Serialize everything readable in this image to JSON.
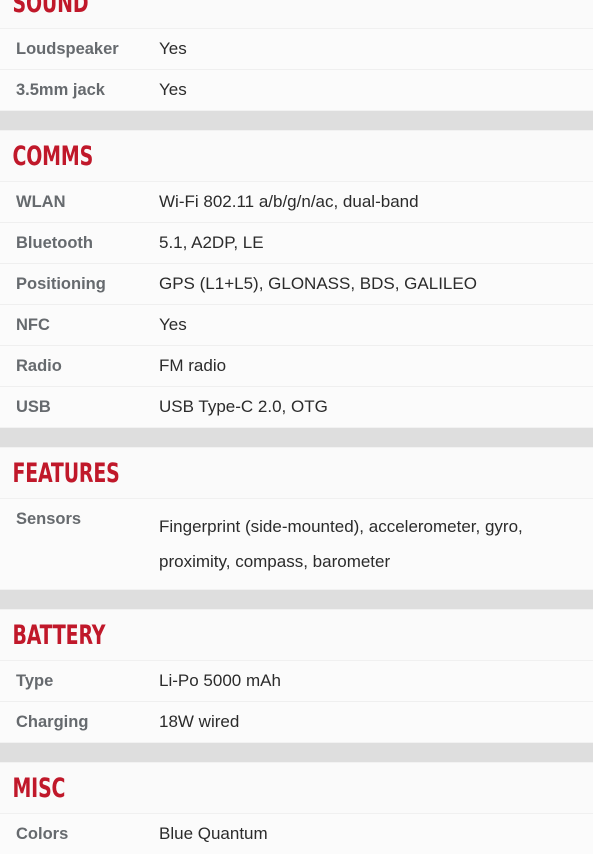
{
  "accent_color": "#c0182a",
  "label_color": "#666a6e",
  "value_color": "#2b2b2b",
  "separator_color": "#dedede",
  "background_color": "#fafafa",
  "page": {
    "type": "phone-specifications-table"
  },
  "sections": [
    {
      "id": "sound",
      "heading": "SOUND",
      "clipped_top": true,
      "rows": [
        {
          "label": "Loudspeaker",
          "value": "Yes"
        },
        {
          "label": "3.5mm jack",
          "value": "Yes"
        }
      ]
    },
    {
      "id": "comms",
      "heading": "COMMS",
      "clipped_top": false,
      "rows": [
        {
          "label": "WLAN",
          "value": "Wi-Fi 802.11 a/b/g/n/ac, dual-band"
        },
        {
          "label": "Bluetooth",
          "value": "5.1, A2DP, LE"
        },
        {
          "label": "Positioning",
          "value": "GPS (L1+L5), GLONASS, BDS, GALILEO"
        },
        {
          "label": "NFC",
          "value": "Yes"
        },
        {
          "label": "Radio",
          "value": "FM radio"
        },
        {
          "label": "USB",
          "value": "USB Type-C 2.0, OTG"
        }
      ]
    },
    {
      "id": "features",
      "heading": "FEATURES",
      "clipped_top": false,
      "rows": [
        {
          "label": "Sensors",
          "value": "Fingerprint (side-mounted), accelerometer, gyro, proximity, compass, barometer"
        }
      ]
    },
    {
      "id": "battery",
      "heading": "BATTERY",
      "clipped_top": false,
      "rows": [
        {
          "label": "Type",
          "value": "Li-Po 5000 mAh"
        },
        {
          "label": "Charging",
          "value": "18W wired"
        }
      ]
    },
    {
      "id": "misc",
      "heading": "MISC",
      "clipped_top": false,
      "rows": [
        {
          "label": "Colors",
          "value": "Blue Quantum"
        }
      ]
    }
  ]
}
